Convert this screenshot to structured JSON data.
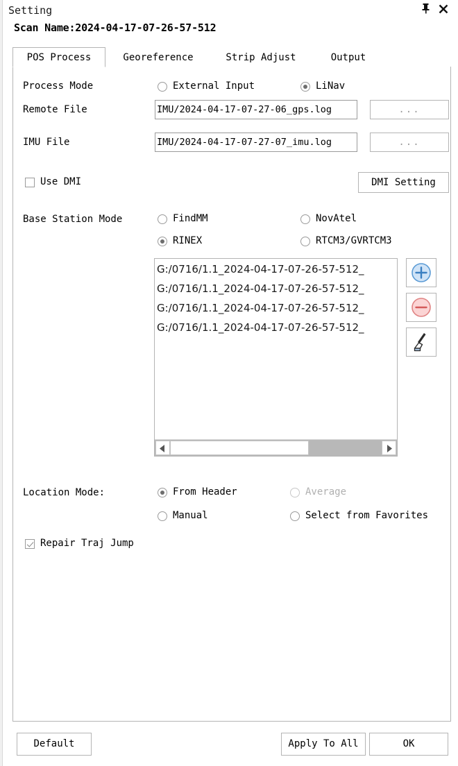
{
  "window": {
    "title": "Setting",
    "pin_icon": "pin-icon",
    "close_icon": "close-icon",
    "scan_name": "Scan Name:2024-04-17-07-26-57-512"
  },
  "tabs": [
    {
      "label": "POS Process",
      "active": true
    },
    {
      "label": "Georeference",
      "active": false
    },
    {
      "label": "Strip Adjust",
      "active": false
    },
    {
      "label": "Output",
      "active": false
    }
  ],
  "pos_process": {
    "process_mode": {
      "label": "Process Mode",
      "options": [
        {
          "label": "External Input",
          "checked": false
        },
        {
          "label": "LiNav",
          "checked": true
        }
      ]
    },
    "remote_file": {
      "label": "Remote File",
      "value": "IMU/2024-04-17-07-27-06_gps.log",
      "browse_label": "..."
    },
    "imu_file": {
      "label": "IMU File",
      "value": "IMU/2024-04-17-07-27-07_imu.log",
      "browse_label": "..."
    },
    "use_dmi": {
      "label": "Use DMI",
      "checked": false
    },
    "dmi_setting_button": "DMI Setting",
    "base_station_mode": {
      "label": "Base Station Mode",
      "options": [
        {
          "label": "FindMM",
          "checked": false
        },
        {
          "label": "NovAtel",
          "checked": false
        },
        {
          "label": "RINEX",
          "checked": true
        },
        {
          "label": "RTCM3/GVRTCM3",
          "checked": false
        }
      ]
    },
    "base_station_files": [
      "G:/0716/1.1_2024-04-17-07-26-57-512_",
      "G:/0716/1.1_2024-04-17-07-26-57-512_",
      "G:/0716/1.1_2024-04-17-07-26-57-512_",
      "G:/0716/1.1_2024-04-17-07-26-57-512_"
    ],
    "list_buttons": [
      {
        "icon": "add-icon",
        "color": "#4a90d9"
      },
      {
        "icon": "remove-icon",
        "color": "#e06060"
      },
      {
        "icon": "clear-brush-icon",
        "color": "#333333"
      }
    ],
    "location_mode": {
      "label": "Location Mode:",
      "options": [
        {
          "label": "From Header",
          "checked": true,
          "disabled": false
        },
        {
          "label": "Average",
          "checked": false,
          "disabled": true
        },
        {
          "label": "Manual",
          "checked": false,
          "disabled": false
        },
        {
          "label": "Select from Favorites",
          "checked": false,
          "disabled": false
        }
      ]
    },
    "repair_traj_jump": {
      "label": "Repair Traj Jump",
      "checked": true
    }
  },
  "footer": {
    "default_button": "Default",
    "apply_to_all_button": "Apply To All",
    "ok_button": "OK"
  }
}
